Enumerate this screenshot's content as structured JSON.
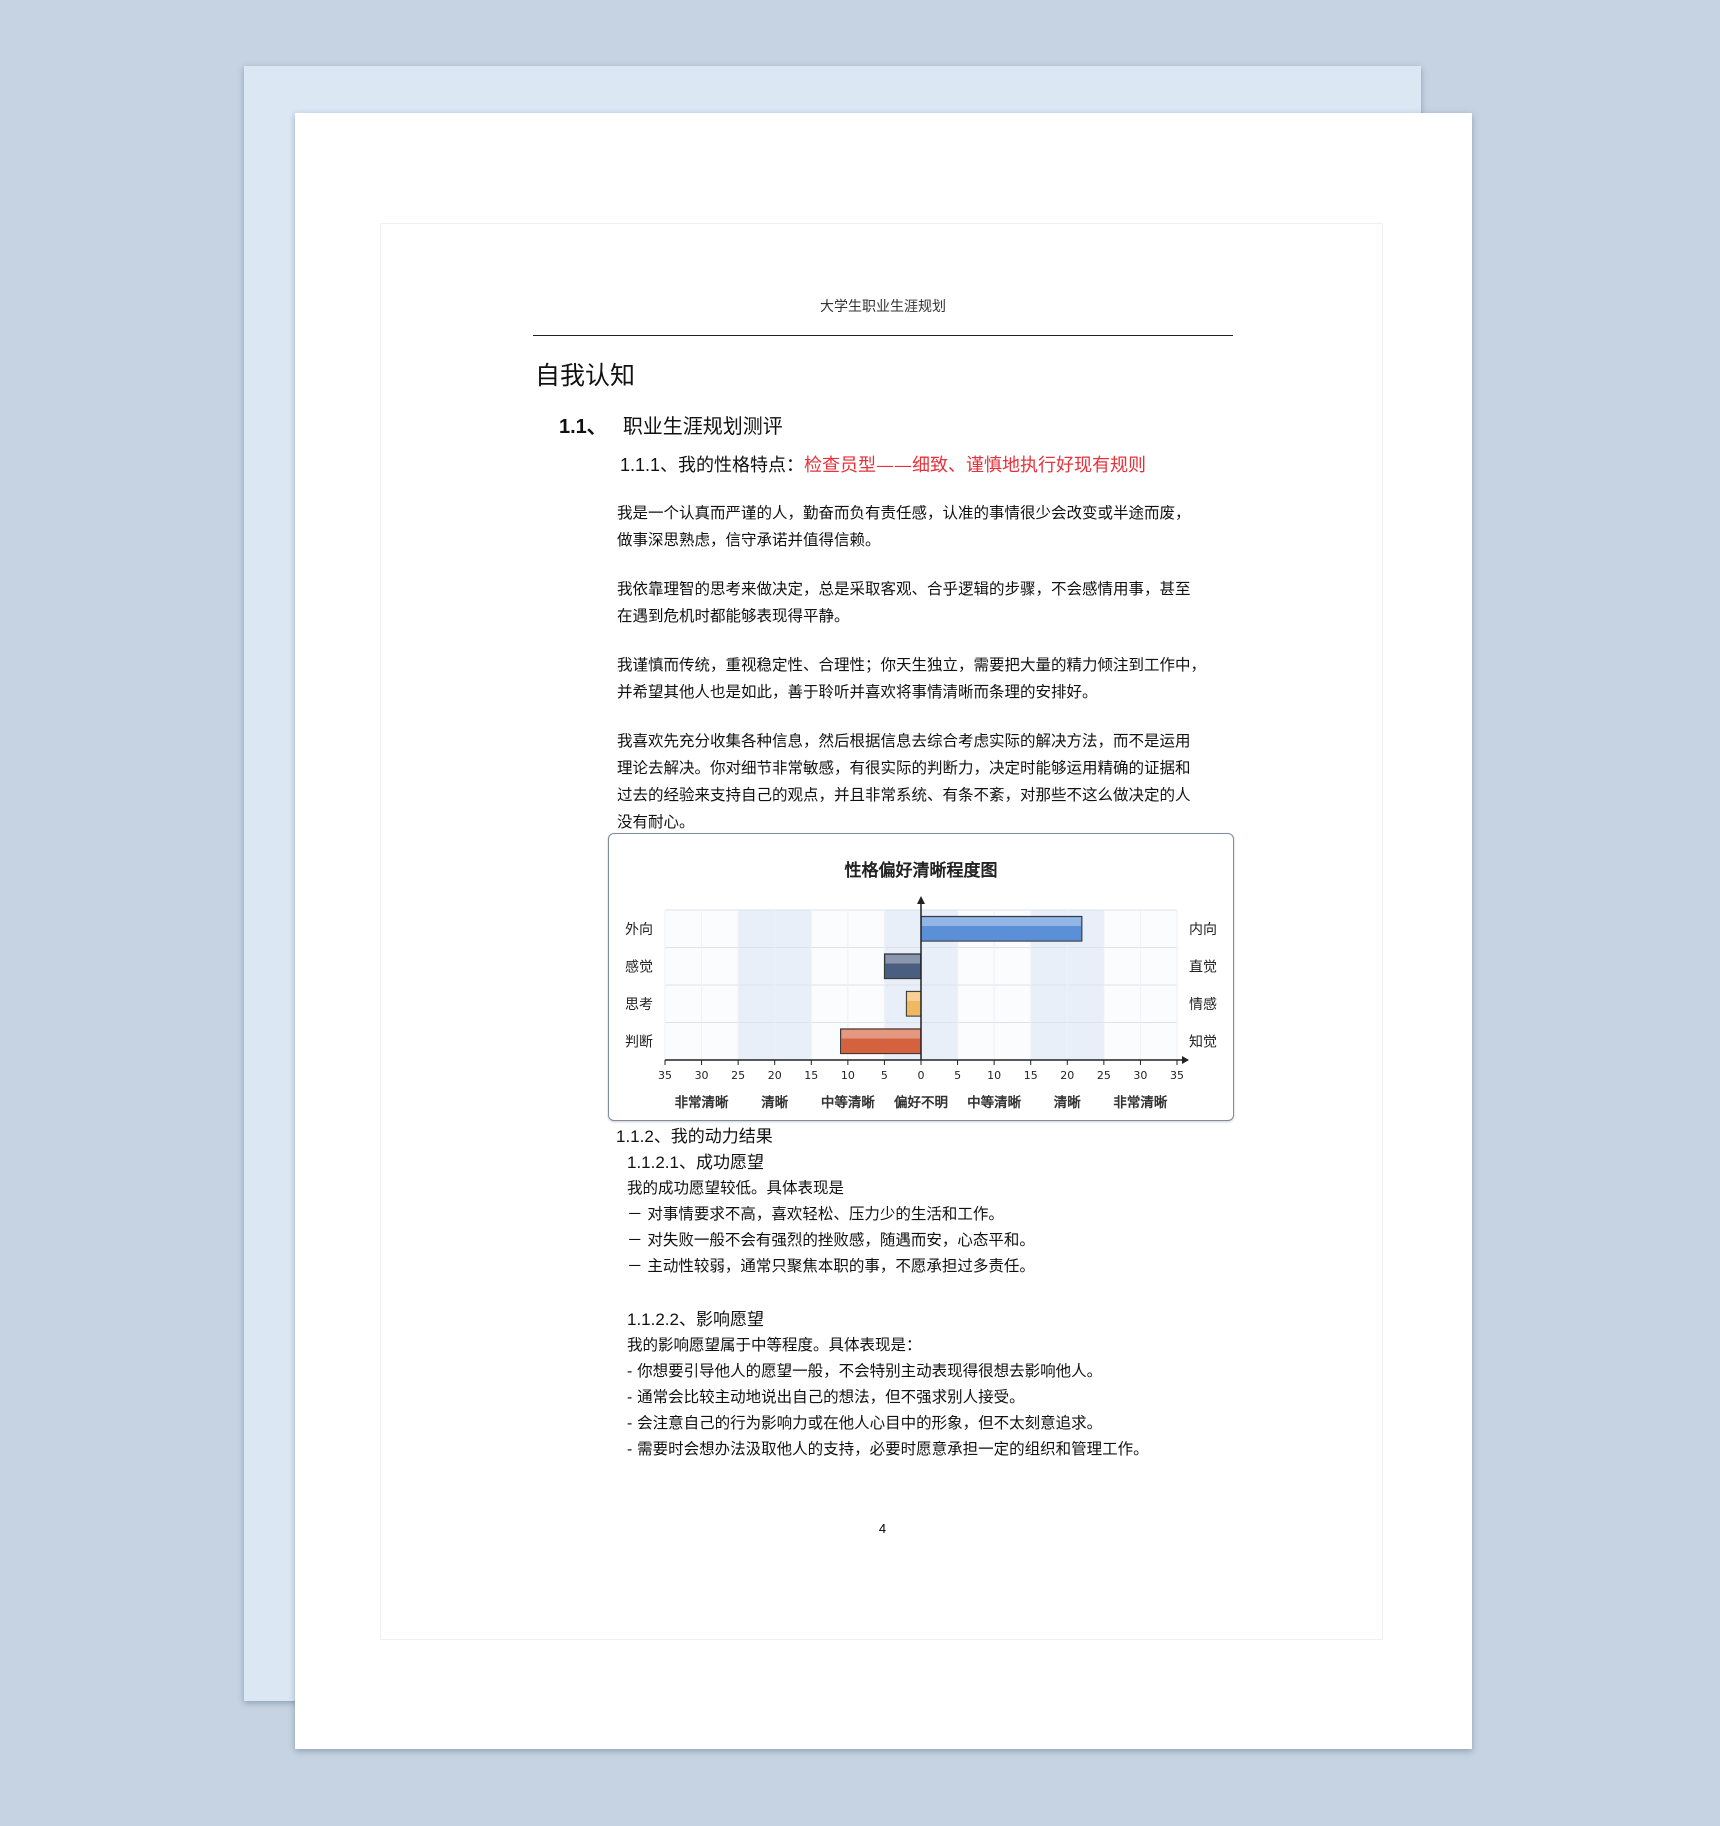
{
  "header": "大学生职业生涯规划",
  "title": "自我认知",
  "section": {
    "num": "1.1、",
    "label": "职业生涯规划测评"
  },
  "subsection": {
    "num": "1.1.1",
    "label": "、我的性格特点：",
    "highlight": "检查员型——细致、谨慎地执行好现有规则"
  },
  "paragraphs": [
    [
      "我是一个认真而严谨的人，勤奋而负有责任感，认准的事情很少会改变或半途而废，",
      "做事深思熟虑，信守承诺并值得信赖。"
    ],
    [
      "我依靠理智的思考来做决定，总是采取客观、合乎逻辑的步骤，不会感情用事，甚至",
      "在遇到危机时都能够表现得平静。"
    ],
    [
      "我谨慎而传统，重视稳定性、合理性；你天生独立，需要把大量的精力倾注到工作中，",
      "并希望其他人也是如此，善于聆听并喜欢将事情清晰而条理的安排好。"
    ],
    [
      "我喜欢先充分收集各种信息，然后根据信息去综合考虑实际的解决方法，而不是运用",
      "理论去解决。你对细节非常敏感，有很实际的判断力，决定时能够运用精确的证据和",
      "过去的经验来支持自己的观点，并且非常系统、有条不紊，对那些不这么做决定的人",
      "没有耐心。"
    ]
  ],
  "chart_data": {
    "type": "bar",
    "orientation": "horizontal",
    "title": "性格偏好清晰程度图",
    "left_labels": [
      "外向",
      "感觉",
      "思考",
      "判断"
    ],
    "right_labels": [
      "内向",
      "直觉",
      "情感",
      "知觉"
    ],
    "values": [
      22,
      -5,
      -2,
      -11
    ],
    "colors": [
      "#5b8fd8",
      "#4a5e80",
      "#f0b860",
      "#d5623f"
    ],
    "xlim": [
      -35,
      35
    ],
    "ticks": [
      35,
      30,
      25,
      20,
      15,
      10,
      5,
      0,
      5,
      10,
      15,
      20,
      25,
      30,
      35
    ],
    "bottom_labels": [
      "非常清晰",
      "清晰",
      "中等清晰",
      "偏好不明",
      "中等清晰",
      "清晰",
      "非常清晰"
    ],
    "bottom_label_positions": [
      -30,
      -20,
      -10,
      0,
      10,
      20,
      30
    ],
    "shaded_bands": [
      [
        -25,
        -15
      ],
      [
        -5,
        0
      ],
      [
        0,
        5
      ],
      [
        15,
        25
      ]
    ]
  },
  "dynamics": {
    "num": "1.1.2",
    "label": "、我的动力结果"
  },
  "success": {
    "num": "1.1.2.1",
    "label": "、成功愿望",
    "intro": "我的成功愿望较低。具体表现是",
    "items": [
      "－ 对事情要求不高，喜欢轻松、压力少的生活和工作。",
      "－ 对失败一般不会有强烈的挫败感，随遇而安，心态平和。",
      "－ 主动性较弱，通常只聚焦本职的事，不愿承担过多责任。"
    ]
  },
  "influence": {
    "num": "1.1.2.2",
    "label": "、影响愿望",
    "intro": "我的影响愿望属于中等程度。具体表现是：",
    "items": [
      "- 你想要引导他人的愿望一般，不会特别主动表现得很想去影响他人。",
      "- 通常会比较主动地说出自己的想法，但不强求别人接受。",
      "- 会注意自己的行为影响力或在他人心目中的形象，但不太刻意追求。",
      "- 需要时会想办法汲取他人的支持，必要时愿意承担一定的组织和管理工作。"
    ]
  },
  "page_number": "4"
}
